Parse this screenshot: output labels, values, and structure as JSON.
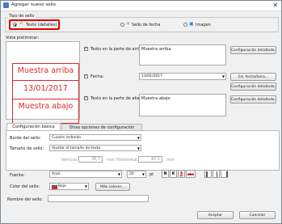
{
  "window": {
    "title": "Agregar nuevo sello",
    "close_glyph": "✕"
  },
  "stamp_type": {
    "group_label": "Tipo de sello",
    "options": [
      {
        "label": "Texto (detalles)",
        "selected": true,
        "icon": "text-stamp-icon"
      },
      {
        "label": "Sello de fecha",
        "selected": false,
        "icon": "date-stamp-icon"
      },
      {
        "label": "Imagen",
        "selected": false,
        "icon": "image-stamp-icon"
      }
    ]
  },
  "preview": {
    "label": "Vista preliminar:",
    "top_text": "Muestra arriba",
    "date_text": "13/01/2017",
    "bottom_text": "Muestra abajo",
    "stamp_color": "#e0282c"
  },
  "fields": {
    "top": {
      "label": "Texto en la parte de arriba:",
      "value": "Muestra arriba",
      "checked": true,
      "button": "Configuración detallada..."
    },
    "date": {
      "label": "Fecha:",
      "value": "13/01/2017",
      "checked": true,
      "button_format": "Ed. fecha/hora...",
      "button_detail": "Configuración detallada..."
    },
    "bottom": {
      "label": "Texto en la parte de abajo:",
      "value": "Muestra abajo",
      "checked": true,
      "button": "Configuración detallada..."
    }
  },
  "tabs": [
    {
      "label": "Configuración básica",
      "active": true
    },
    {
      "label": "Otras opciones de configuración",
      "active": false
    }
  ],
  "basic": {
    "border_label": "Borde del sello:",
    "border_value": "Cuadro redondo",
    "size_label": "Tamaño de sello:",
    "size_value": "Ajustar el tamaño de texto",
    "vertical_label": "Vertical:",
    "vertical_value": "38,7",
    "vertical_unit": "mm",
    "horizontal_label": "Horizontal:",
    "horizontal_value": "40,5",
    "horizontal_unit": "mm",
    "font_label": "Fuente:",
    "font_value": "Arial",
    "font_size": "20",
    "font_unit": "pt",
    "format_buttons": [
      "N",
      "K",
      "S",
      "abc"
    ],
    "color_label": "Color del sello:",
    "color_value": "Rojo",
    "color_swatch": "#e0282c",
    "more_colors": "Más colores..."
  },
  "stamp_name": {
    "label": "Nombre del sello:",
    "value": ""
  },
  "actions": {
    "accept": "Aceptar",
    "cancel": "Cancelar"
  }
}
